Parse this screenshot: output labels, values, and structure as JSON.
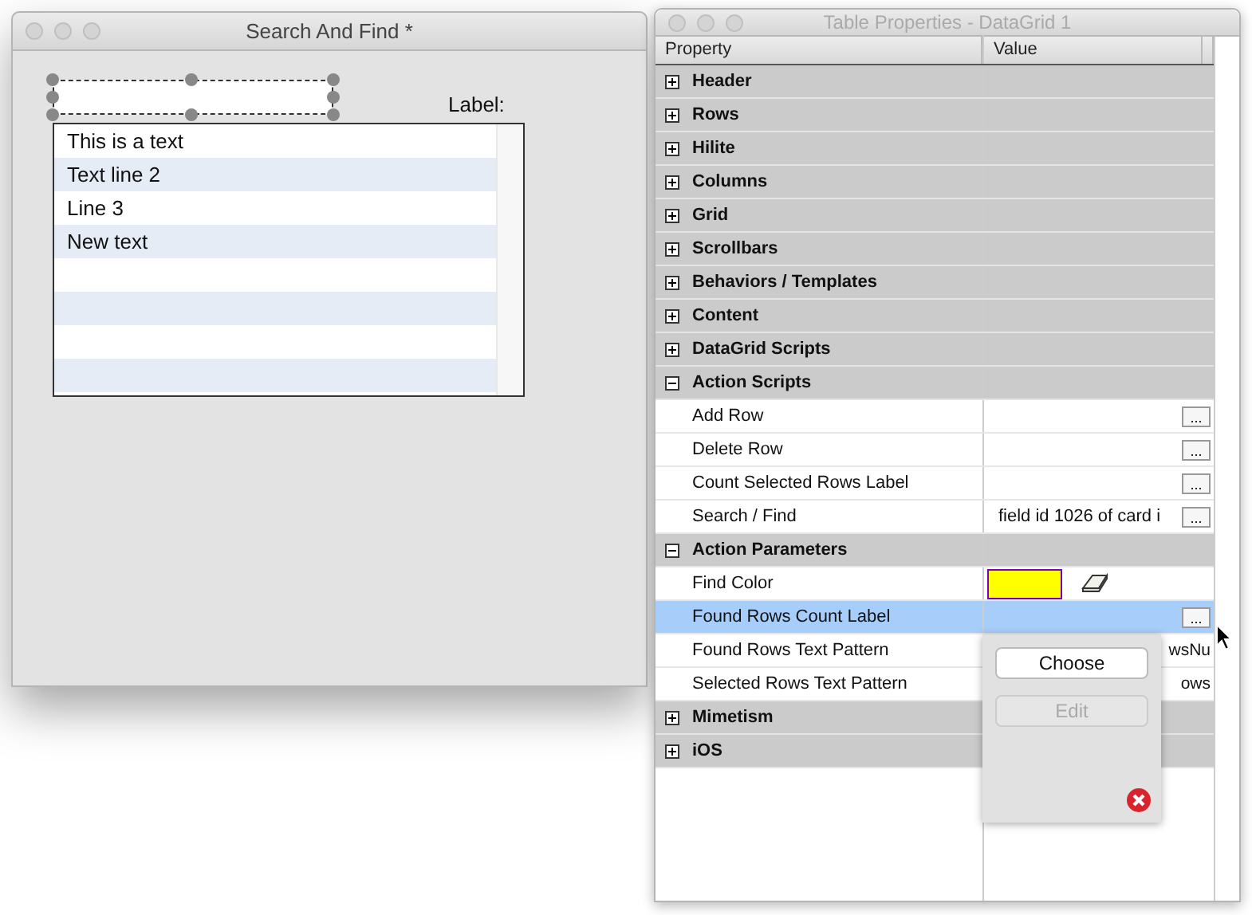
{
  "left_window": {
    "title": "Search And Find *",
    "label": "Label:",
    "list_rows": [
      {
        "text": "This is a text"
      },
      {
        "text": "Text line 2"
      },
      {
        "text": "Line 3"
      },
      {
        "text": "New text"
      },
      {},
      {},
      {},
      {}
    ]
  },
  "right_window": {
    "title": "Table Properties - DataGrid 1",
    "columns": [
      "Property",
      "Value"
    ],
    "rows": [
      {
        "kind": "group",
        "label": "Header",
        "expanded": false
      },
      {
        "kind": "group",
        "label": "Rows",
        "expanded": false
      },
      {
        "kind": "group",
        "label": "Hilite",
        "expanded": false
      },
      {
        "kind": "group",
        "label": "Columns",
        "expanded": false
      },
      {
        "kind": "group",
        "label": "Grid",
        "expanded": false
      },
      {
        "kind": "group",
        "label": "Scrollbars",
        "expanded": false
      },
      {
        "kind": "group",
        "label": "Behaviors / Templates",
        "expanded": false
      },
      {
        "kind": "group",
        "label": "Content",
        "expanded": false
      },
      {
        "kind": "group",
        "label": "DataGrid Scripts",
        "expanded": false
      },
      {
        "kind": "group",
        "label": "Action Scripts",
        "expanded": true
      },
      {
        "kind": "item",
        "label": "Add Row",
        "button": "...",
        "selected": false
      },
      {
        "kind": "item",
        "label": "Delete Row",
        "button": "...",
        "selected": false
      },
      {
        "kind": "item",
        "label": "Count Selected Rows Label",
        "button": "...",
        "selected": false
      },
      {
        "kind": "item",
        "label": "Search / Find",
        "value": "field id 1026 of card i",
        "button": "...",
        "selected": false
      },
      {
        "kind": "group",
        "label": "Action Parameters",
        "expanded": true
      },
      {
        "kind": "color",
        "label": "Find Color",
        "color": "#ffff00",
        "selected": false
      },
      {
        "kind": "item",
        "label": "Found Rows Count Label",
        "button": "...",
        "selected": true
      },
      {
        "kind": "item",
        "label": "Found Rows Text Pattern",
        "tail": "wsNu",
        "selected": false
      },
      {
        "kind": "item",
        "label": "Selected Rows Text Pattern",
        "tail": "ows",
        "selected": false
      },
      {
        "kind": "group",
        "label": "Mimetism",
        "expanded": false
      },
      {
        "kind": "group",
        "label": "iOS",
        "expanded": false
      }
    ],
    "popover": {
      "buttons": [
        {
          "label": "Choose",
          "disabled": false
        },
        {
          "label": "Edit",
          "disabled": true
        }
      ]
    }
  }
}
